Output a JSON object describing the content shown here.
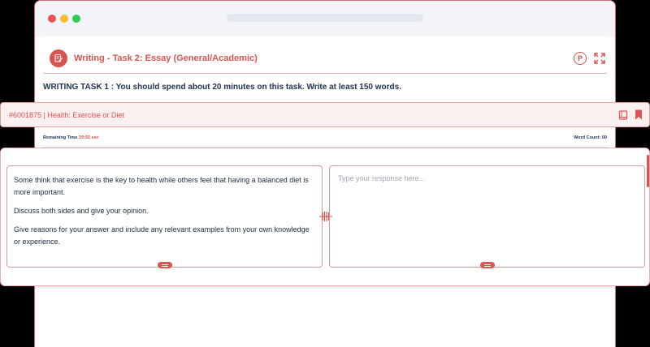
{
  "window": {
    "controls": [
      "close",
      "minimize",
      "maximize"
    ]
  },
  "header": {
    "task_icon": "edit-document-icon",
    "title": "Writing - Task 2: Essay (General/Academic)",
    "p_button_label": "P",
    "expand_icon": "expand-icon"
  },
  "instruction": "WRITING TASK 1 : You should spend about 20 minutes on this task. Write at least 150 words.",
  "question_bar": {
    "label": "#6001875 | Health: Exercise or Diet",
    "icons": [
      "book-icon",
      "bookmark-icon"
    ]
  },
  "status": {
    "remaining_label": "Remaining Time",
    "remaining_value": "39:55 sec",
    "word_count_label": "Word Count:",
    "word_count_value": "00"
  },
  "question": {
    "paragraphs": [
      "Some think that exercise is the key to health while others feel that having a balanced diet is more important.",
      "Discuss both sides and give your opinion.",
      "Give reasons for your answer and include any relevant examples from your own knowledge or experience."
    ]
  },
  "response": {
    "value": "",
    "placeholder": "Type your response here..."
  },
  "colors": {
    "accent": "#d9534f",
    "text_dark": "#1f3350",
    "question_bar_bg": "#fcefef",
    "titlebar_bg": "#f2f4f8"
  }
}
